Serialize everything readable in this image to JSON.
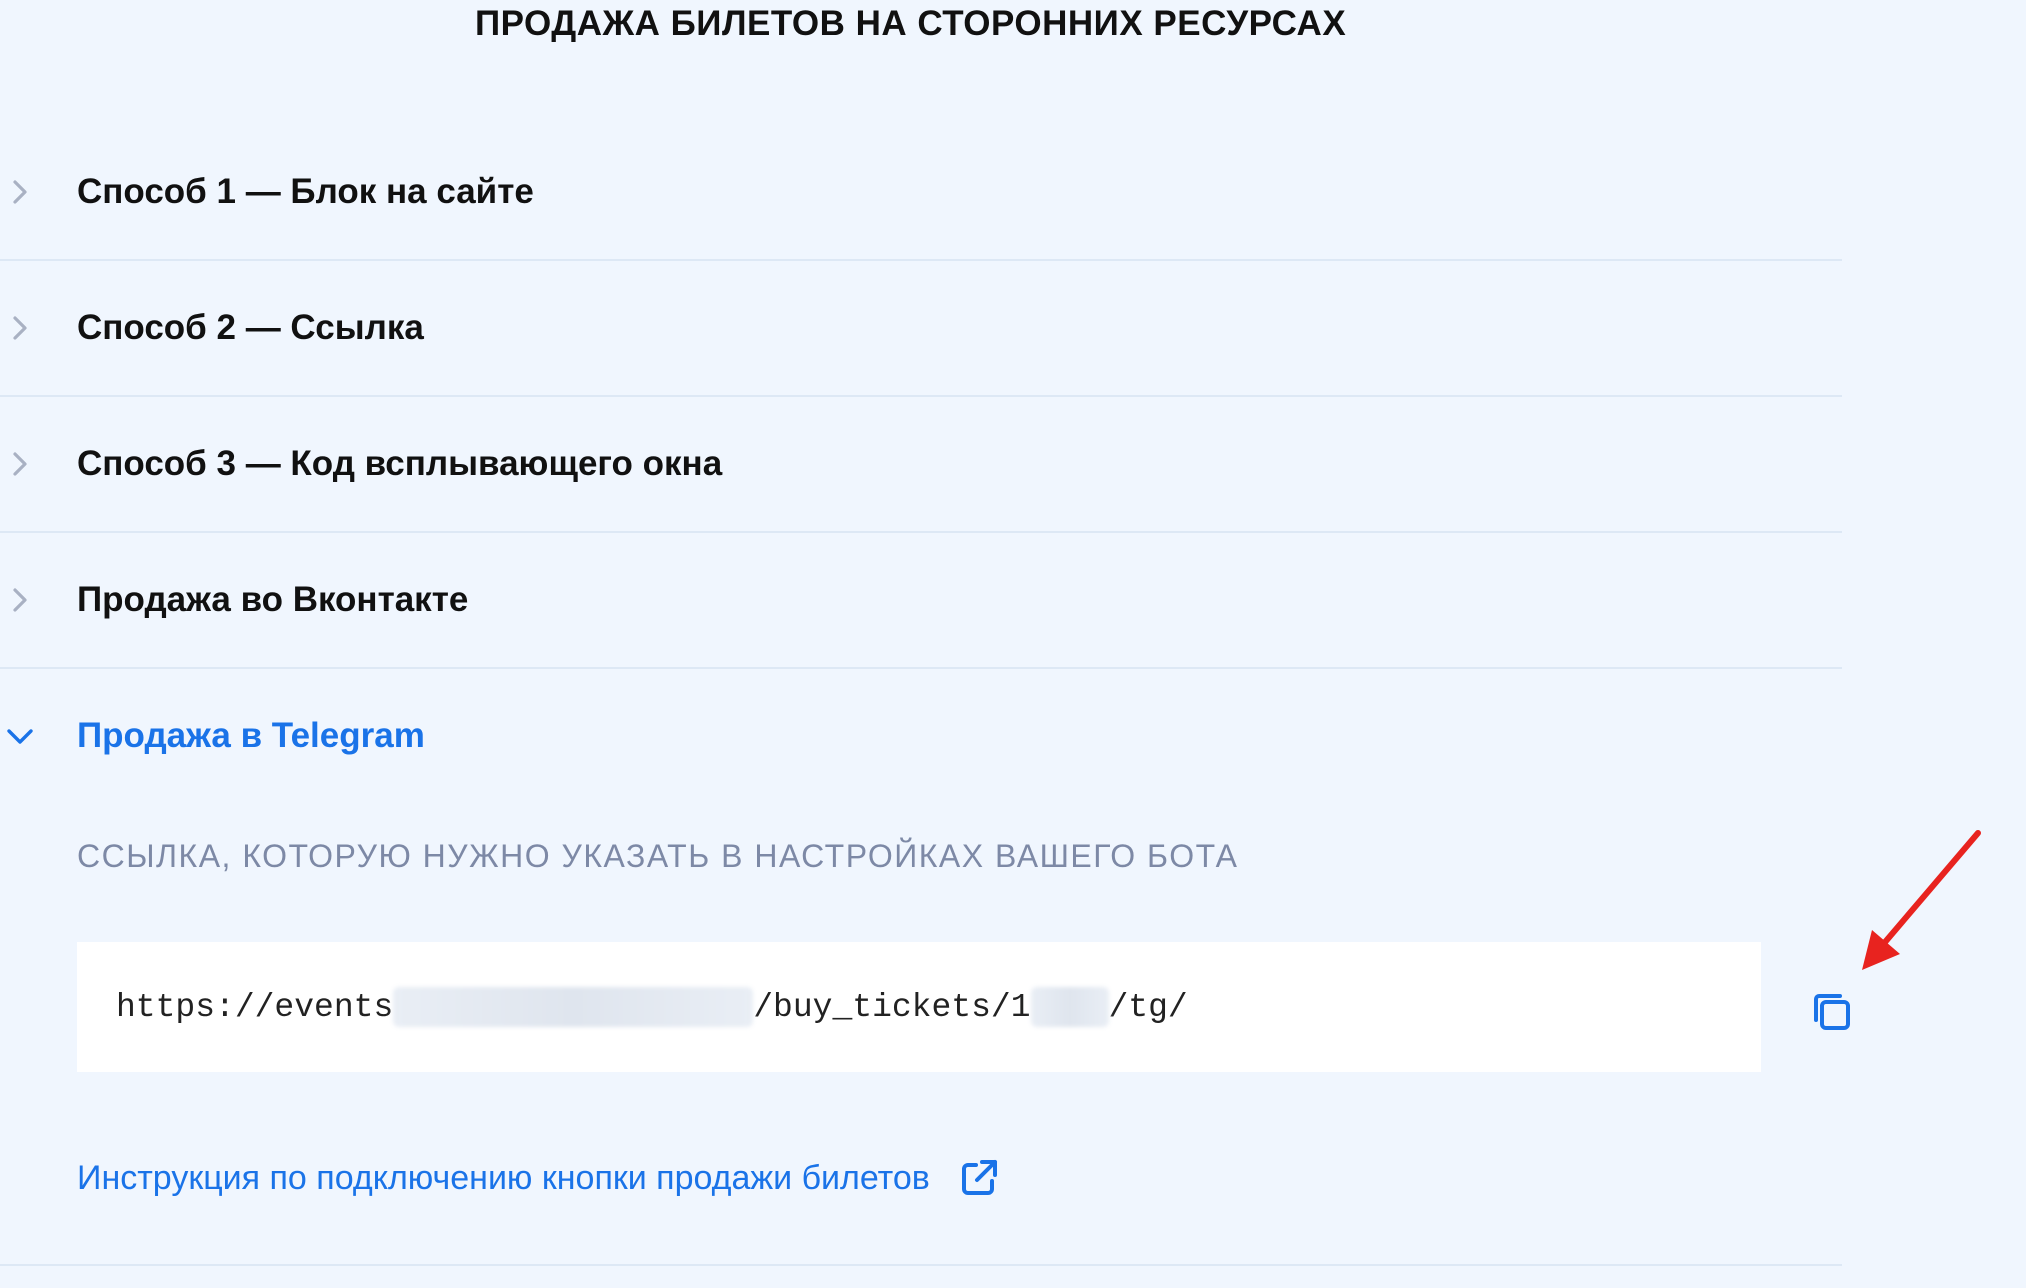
{
  "page": {
    "title": "ПРОДАЖА БИЛЕТОВ НА СТОРОННИХ РЕСУРСАХ"
  },
  "accordion": {
    "items": [
      {
        "label": "Способ 1 — Блок на сайте",
        "expanded": false
      },
      {
        "label": "Способ 2 — Ссылка",
        "expanded": false
      },
      {
        "label": "Способ 3 — Код всплывающего окна",
        "expanded": false
      },
      {
        "label": "Продажа во Вконтакте",
        "expanded": false
      },
      {
        "label": "Продажа в Telegram",
        "expanded": true
      }
    ]
  },
  "telegram": {
    "hint": "ССЫЛКА, КОТОРУЮ НУЖНО УКАЗАТЬ В НАСТРОЙКАХ ВАШЕГО БОТА",
    "link_prefix": "https://events",
    "link_middle": "/buy_tickets/1",
    "link_suffix": "/tg/",
    "copy_icon": "copy-icon",
    "instruction_link": "Инструкция по подключению кнопки продажи билетов",
    "instruction_icon": "external-link-icon"
  },
  "colors": {
    "accent": "#1a73e8",
    "background": "#f0f6fe",
    "hint": "#7d89a6",
    "annotation_arrow": "#e8231f"
  }
}
